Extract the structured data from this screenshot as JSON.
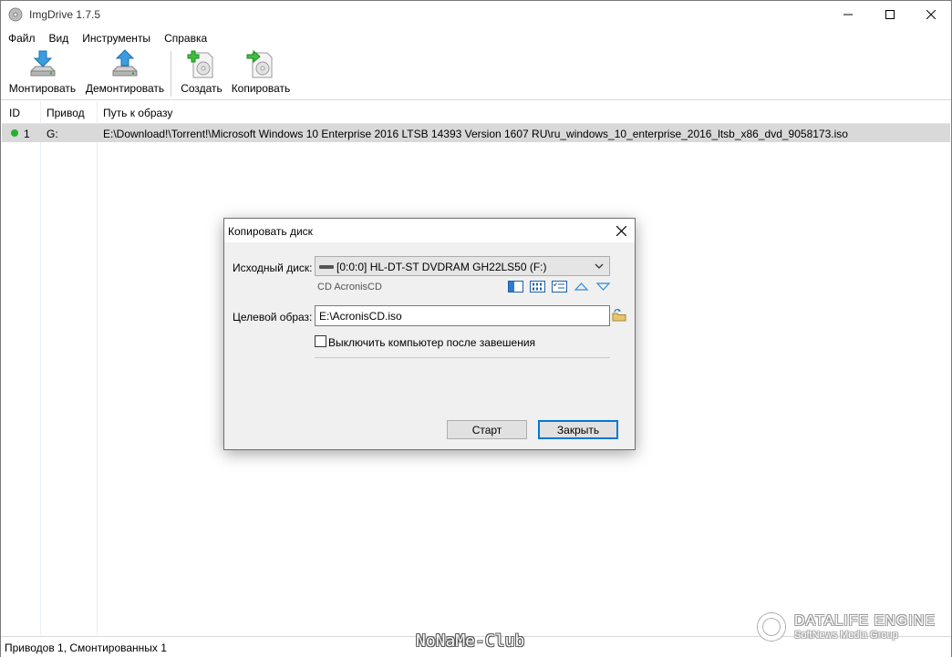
{
  "window": {
    "title": "ImgDrive 1.7.5"
  },
  "menu": [
    "Файл",
    "Вид",
    "Инструменты",
    "Справка"
  ],
  "toolbar": {
    "mount_label": "Монтировать",
    "unmount_label": "Демонтировать",
    "create_label": "Создать",
    "copy_label": "Копировать"
  },
  "table": {
    "columns": [
      "ID",
      "Привод",
      "Путь к образу"
    ],
    "rows": [
      {
        "status": "mounted",
        "id": "1",
        "drive": "G:",
        "path": "E:\\Download!\\Torrent!\\Microsoft Windows 10 Enterprise 2016 LTSB 14393 Version 1607 RU\\ru_windows_10_enterprise_2016_ltsb_x86_dvd_9058173.iso"
      }
    ]
  },
  "status": {
    "text": "Приводов 1, Смонтированных 1"
  },
  "dialog": {
    "title": "Копировать диск",
    "source_label": "Исходный диск:",
    "source_value": "[0:0:0] HL-DT-ST DVDRAM GH22LS50 (F:)",
    "source_volume": "CD AcronisCD",
    "target_label": "Целевой образ:",
    "target_value": "E:\\AcronisCD.iso",
    "shutdown_label": "Выключить компьютер после завешения",
    "shutdown_checked": false,
    "start_label": "Старт",
    "close_label": "Закрыть"
  },
  "watermarks": {
    "noname": "NoNaMe-Club",
    "dle_title": "DATALIFE ENGINE",
    "dle_sub": "SoftNews Media Group"
  },
  "colors": {
    "accent": "#0078d7",
    "selected_row": "#d9d9d9",
    "mounted_dot": "#27b02a"
  }
}
